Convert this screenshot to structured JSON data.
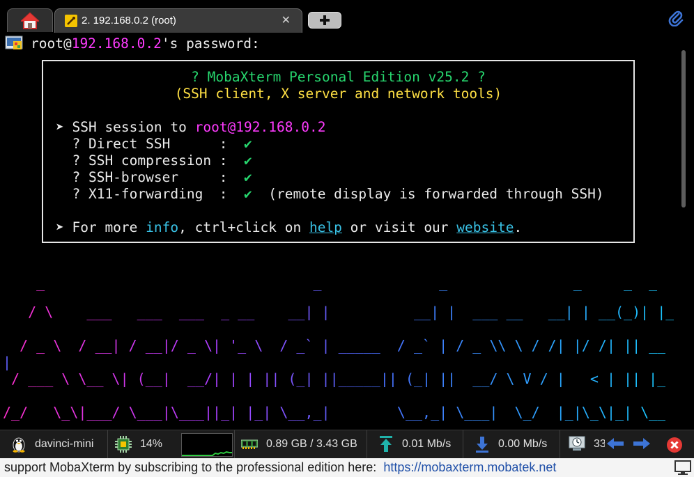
{
  "tabs": {
    "home_icon": "home-icon",
    "session_label": "2. 192.168.0.2 (root)",
    "close_glyph": "✕",
    "new_tab_icon": "plus-icon",
    "attach_icon": "paperclip-icon"
  },
  "terminal": {
    "prompt": {
      "user": "root@",
      "host": "192.168.0.2",
      "suffix": "'s password:"
    },
    "banner": {
      "title": "? MobaXterm Personal Edition v25.2 ?",
      "subtitle": "(SSH client, X server and network tools)",
      "session_prefix": "➤ SSH session to ",
      "session_target": "root@192.168.0.2",
      "features": [
        {
          "label": "  ? Direct SSH      :  ",
          "check": "✔",
          "note": ""
        },
        {
          "label": "  ? SSH compression :  ",
          "check": "✔",
          "note": ""
        },
        {
          "label": "  ? SSH-browser     :  ",
          "check": "✔",
          "note": ""
        },
        {
          "label": "  ? X11-forwarding  :  ",
          "check": "✔",
          "note": "  (remote display is forwarded through SSH)"
        }
      ],
      "more_prefix": "➤ For more ",
      "more_info": "info",
      "more_mid": ", ctrl+click on ",
      "more_help": "help",
      "more_or": " or visit our ",
      "more_website": "website",
      "more_end": "."
    },
    "ascii_art": [
      "    _                                _              _               _     _  _",
      "   / \\    ___   ___  ___  _ __    __| |          __| |  ___ __   __| | __(_)| |_",
      "  / _ \\  / __| / __|/ _ \\| '_ \\  / _` | _____  / _` | / _ \\\\ \\ / /| |/ /| || __",
      "|",
      " / ___ \\ \\__ \\| (__|  __/| | | || (_| ||_____|| (_| ||  __/ \\ V / |   < | || |_",
      "/_/   \\_\\|___/ \\___|\\___||_| |_| \\__,_|        \\__,_| \\___|  \\_/  |_|\\_\\|_| \\__"
    ]
  },
  "statusbar": {
    "host": "davinci-mini",
    "cpu": "14%",
    "memory": "0.89 GB / 3.43 GB",
    "upload": "0.01 Mb/s",
    "download": "0.00 Mb/s",
    "uptime": "33"
  },
  "footer": {
    "promo": "support MobaXterm by subscribing to the professional edition here:  ",
    "url": "https://mobaxterm.mobatek.net"
  },
  "colors": {
    "magenta": "#ff3bff",
    "green": "#27d66e",
    "yellow": "#ffe044",
    "cyan": "#39c2e6",
    "background": "#000000"
  }
}
